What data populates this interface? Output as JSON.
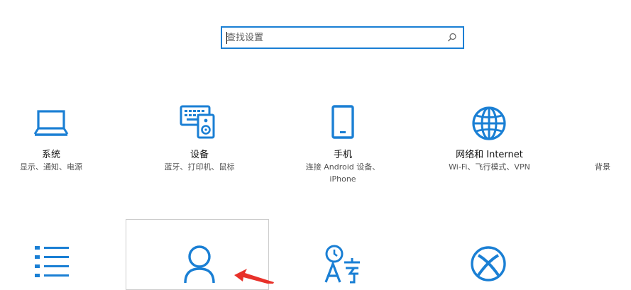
{
  "search": {
    "placeholder": "查找设置",
    "icon": "search-icon"
  },
  "accent": "#1a7fd4",
  "tiles": [
    {
      "name": "系统",
      "desc": [
        "显示、通知、电源"
      ],
      "icon": "laptop-icon"
    },
    {
      "name": "设备",
      "desc": [
        "蓝牙、打印机、鼠标"
      ],
      "icon": "keyboard-speaker-icon"
    },
    {
      "name": "手机",
      "desc": [
        "连接 Android 设备、",
        "iPhone"
      ],
      "icon": "phone-icon"
    },
    {
      "name": "网络和 Internet",
      "desc": [
        "Wi-Fi、飞行模式、VPN"
      ],
      "icon": "globe-icon"
    },
    {
      "name": "",
      "desc": [
        "背景"
      ],
      "icon": ""
    }
  ],
  "row2": [
    {
      "icon": "apps-list-icon"
    },
    {
      "icon": "person-icon"
    },
    {
      "icon": "time-language-icon"
    },
    {
      "icon": "xbox-icon"
    }
  ]
}
